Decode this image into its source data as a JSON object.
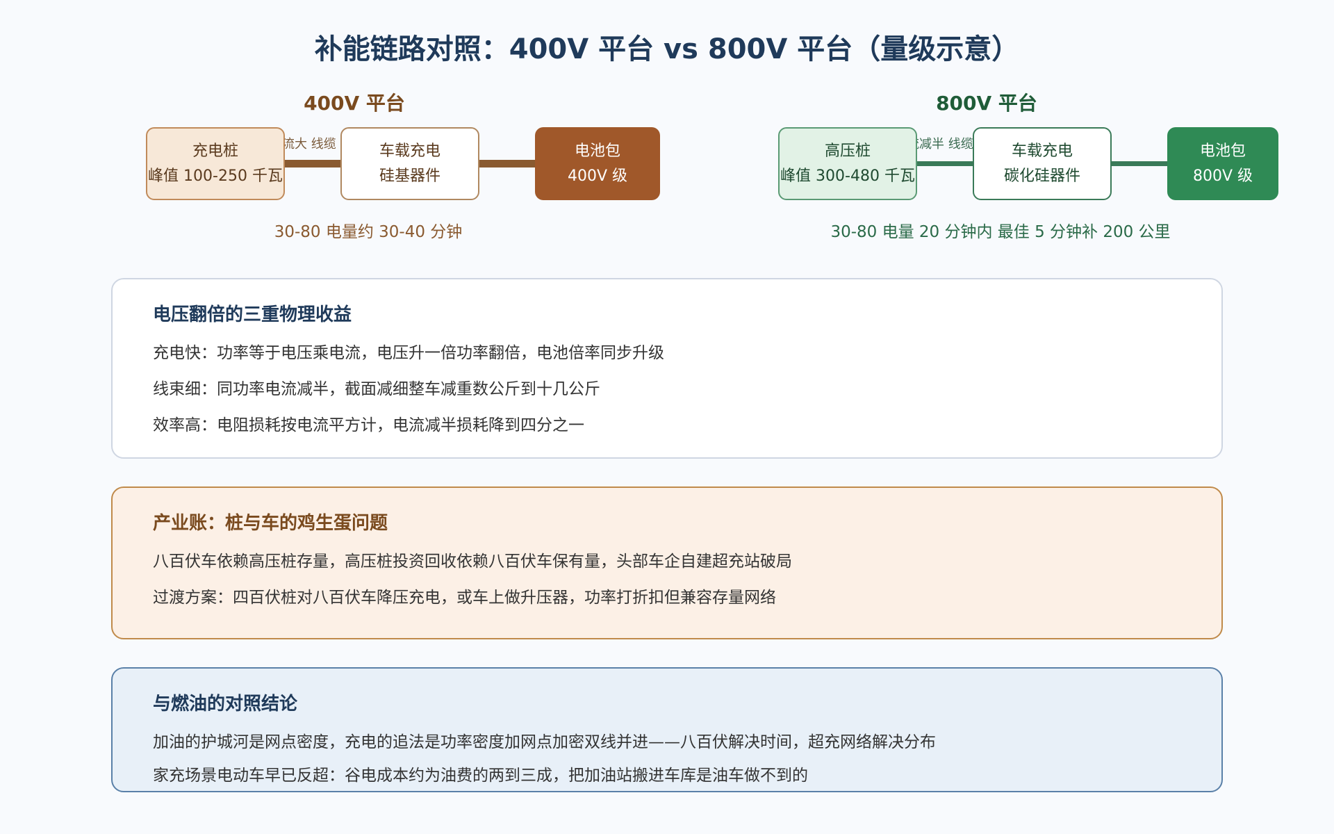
{
  "title": "补能链路对照：400V 平台 vs 800V 平台（量级示意）",
  "colors": {
    "brown": "#a0582a",
    "brown_dark": "#7a4a1e",
    "green": "#2f8a55",
    "green_dark": "#1f5c38",
    "navy": "#1f3a5a"
  },
  "platform_400": {
    "title": "400V 平台",
    "charger": {
      "line1": "充电桩",
      "line2": "峰值 100-250 千瓦"
    },
    "link1_label": "电流大 线缆",
    "onboard": {
      "line1": "车载充电",
      "line2": "硅基器件"
    },
    "battery": {
      "line1": "电池包",
      "line2": "400V 级"
    },
    "summary": "30-80 电量约 30-40 分钟"
  },
  "platform_800": {
    "title": "800V 平台",
    "charger": {
      "line1": "高压桩",
      "line2": "峰值 300-480 千瓦"
    },
    "link1_label": "电流减半 线缆",
    "onboard": {
      "line1": "车载充电",
      "line2": "碳化硅器件"
    },
    "battery": {
      "line1": "电池包",
      "line2": "800V 级"
    },
    "summary": "30-80 电量 20 分钟内 最佳 5 分钟补 200 公里"
  },
  "cards": {
    "physics": {
      "title": "电压翻倍的三重物理收益",
      "lines": [
        "充电快：功率等于电压乘电流，电压升一倍功率翻倍，电池倍率同步升级",
        "线束细：同功率电流减半，截面减细整车减重数公斤到十几公斤",
        "效率高：电阻损耗按电流平方计，电流减半损耗降到四分之一"
      ]
    },
    "industry": {
      "title": "产业账：桩与车的鸡生蛋问题",
      "lines": [
        "八百伏车依赖高压桩存量，高压桩投资回收依赖八百伏车保有量，头部车企自建超充站破局",
        "过渡方案：四百伏桩对八百伏车降压充电，或车上做升压器，功率打折扣但兼容存量网络"
      ]
    },
    "conclusion": {
      "title": "与燃油的对照结论",
      "lines": [
        "加油的护城河是网点密度，充电的追法是功率密度加网点加密双线并进——八百伏解决时间，超充网络解决分布",
        "家充场景电动车早已反超：谷电成本约为油费的两到三成，把加油站搬进车库是油车做不到的"
      ]
    }
  }
}
